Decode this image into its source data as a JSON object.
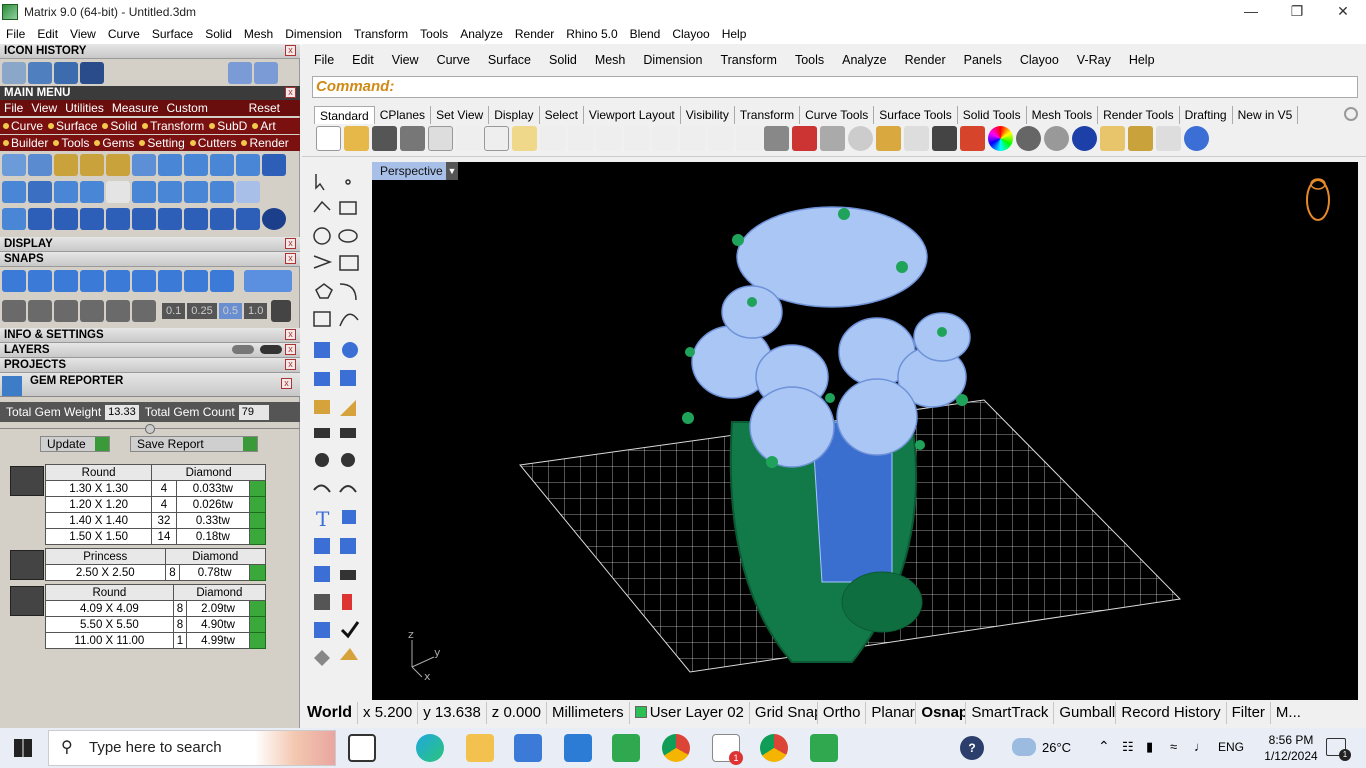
{
  "window": {
    "title": "Matrix 9.0 (64-bit) - Untitled.3dm"
  },
  "menubar": [
    "File",
    "Edit",
    "View",
    "Curve",
    "Surface",
    "Solid",
    "Mesh",
    "Dimension",
    "Transform",
    "Tools",
    "Analyze",
    "Render",
    "Rhino 5.0",
    "Blend",
    "Clayoo",
    "Help"
  ],
  "left_panel": {
    "icon_history": "ICON HISTORY",
    "main_menu": "MAIN MENU",
    "submenu": [
      "File",
      "View",
      "Utilities",
      "Measure",
      "Custom"
    ],
    "reset": "Reset",
    "tabs_row1": [
      "Curve",
      "Surface",
      "Solid",
      "Transform",
      "SubD",
      "Art"
    ],
    "tabs_row2": [
      "Builder",
      "Tools",
      "Gems",
      "Setting",
      "Cutters",
      "Render"
    ],
    "display": "DISPLAY",
    "snaps": "SNAPS",
    "snap_values": [
      "0.1",
      "0.25",
      "0.5",
      "1.0"
    ],
    "info": "INFO & SETTINGS",
    "layers": "LAYERS",
    "projects": "PROJECTS",
    "gem_reporter": "GEM REPORTER",
    "total_weight_label": "Total Gem Weight",
    "total_weight": "13.33",
    "total_count_label": "Total Gem Count",
    "total_count": "79",
    "update": "Update",
    "save_report": "Save Report",
    "groups": [
      {
        "shape": "Round",
        "material": "Diamond",
        "rows": [
          [
            "1.30 X 1.30",
            "4",
            "0.033tw"
          ],
          [
            "1.20 X 1.20",
            "4",
            "0.026tw"
          ],
          [
            "1.40 X 1.40",
            "32",
            "0.33tw"
          ],
          [
            "1.50 X 1.50",
            "14",
            "0.18tw"
          ]
        ]
      },
      {
        "shape": "Princess",
        "material": "Diamond",
        "rows": [
          [
            "2.50 X 2.50",
            "8",
            "0.78tw"
          ]
        ]
      },
      {
        "shape": "Round",
        "material": "Diamond",
        "rows": [
          [
            "4.09 X 4.09",
            "8",
            "2.09tw"
          ],
          [
            "5.50 X 5.50",
            "8",
            "4.90tw"
          ],
          [
            "11.00 X 11.00",
            "1",
            "4.99tw"
          ]
        ]
      }
    ]
  },
  "rhino_menu": [
    "File",
    "Edit",
    "View",
    "Curve",
    "Surface",
    "Solid",
    "Mesh",
    "Dimension",
    "Transform",
    "Tools",
    "Analyze",
    "Render",
    "Panels",
    "Clayoo",
    "V-Ray",
    "Help"
  ],
  "command": "Command:",
  "tabs": [
    "Standard",
    "CPlanes",
    "Set View",
    "Display",
    "Select",
    "Viewport Layout",
    "Visibility",
    "Transform",
    "Curve Tools",
    "Surface Tools",
    "Solid Tools",
    "Mesh Tools",
    "Render Tools",
    "Drafting",
    "New in V5"
  ],
  "viewport": {
    "label": "Perspective",
    "axes": [
      "z",
      "y",
      "x"
    ]
  },
  "status": [
    "World",
    "x 5.200",
    "y 13.638",
    "z 0.000",
    "Millimeters",
    "User Layer 02",
    "Grid Snap",
    "Ortho",
    "Planar",
    "Osnap",
    "SmartTrack",
    "Gumball",
    "Record History",
    "Filter",
    "M..."
  ],
  "taskbar": {
    "search": "Type here to search",
    "temp": "26°C",
    "lang": "ENG",
    "time": "8:56 PM",
    "date": "1/12/2024",
    "mail_badge": "1",
    "notif": "1"
  }
}
